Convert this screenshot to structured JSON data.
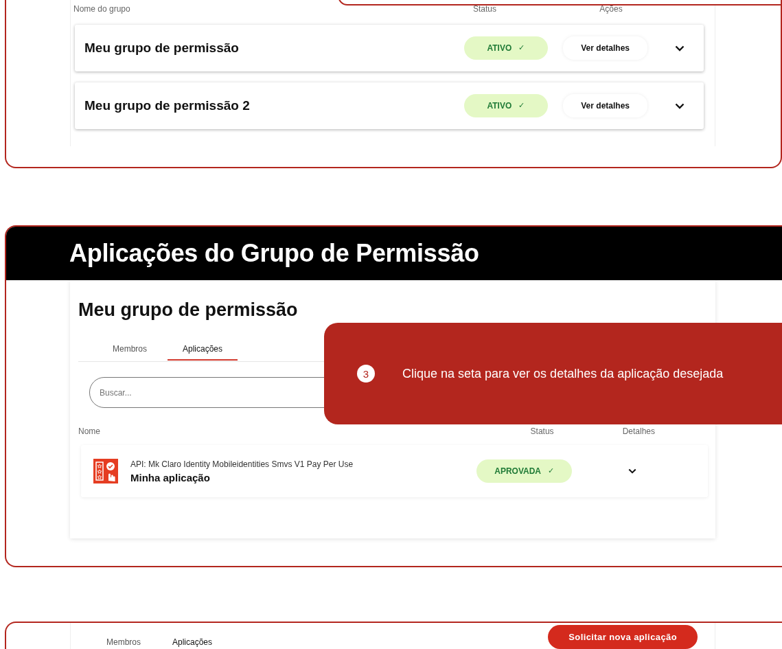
{
  "groups_section": {
    "columns": [
      "Nome do grupo",
      "Status",
      "Ações"
    ],
    "rows": [
      {
        "name": "Meu grupo de permissão",
        "status": "ATIVO",
        "status_icon": "✓",
        "action": "Ver detalhes",
        "expanded": false
      },
      {
        "name": "Meu grupo de permissão 2",
        "status": "ATIVO",
        "status_icon": "✓",
        "action": "Ver detalhes",
        "expanded": false
      }
    ]
  },
  "applications_section": {
    "header": "Aplicações do Grupo de Permissão",
    "group_title": "Meu grupo de permissão",
    "tabs": [
      {
        "label": "Membros",
        "selected": false
      },
      {
        "label": "Aplicações",
        "selected": true
      }
    ],
    "search": {
      "placeholder": "Buscar..."
    },
    "tooltip": {
      "step": "3",
      "text": "Clique na seta para ver os detalhes da aplicação desejada"
    },
    "columns": [
      "Nome",
      "Status",
      "Detalhes"
    ],
    "rows": [
      {
        "api": "API: Mk Claro Identity Mobileidentities Smvs V1 Pay Per Use",
        "name": "Minha aplicação",
        "status": "APROVADA",
        "status_icon": "✓",
        "expanded": false
      }
    ]
  },
  "bottom_section": {
    "tabs": [
      {
        "label": "Membros",
        "selected": false
      },
      {
        "label": "Aplicações",
        "selected": true
      }
    ],
    "button": "Solicitar nova aplicação"
  }
}
